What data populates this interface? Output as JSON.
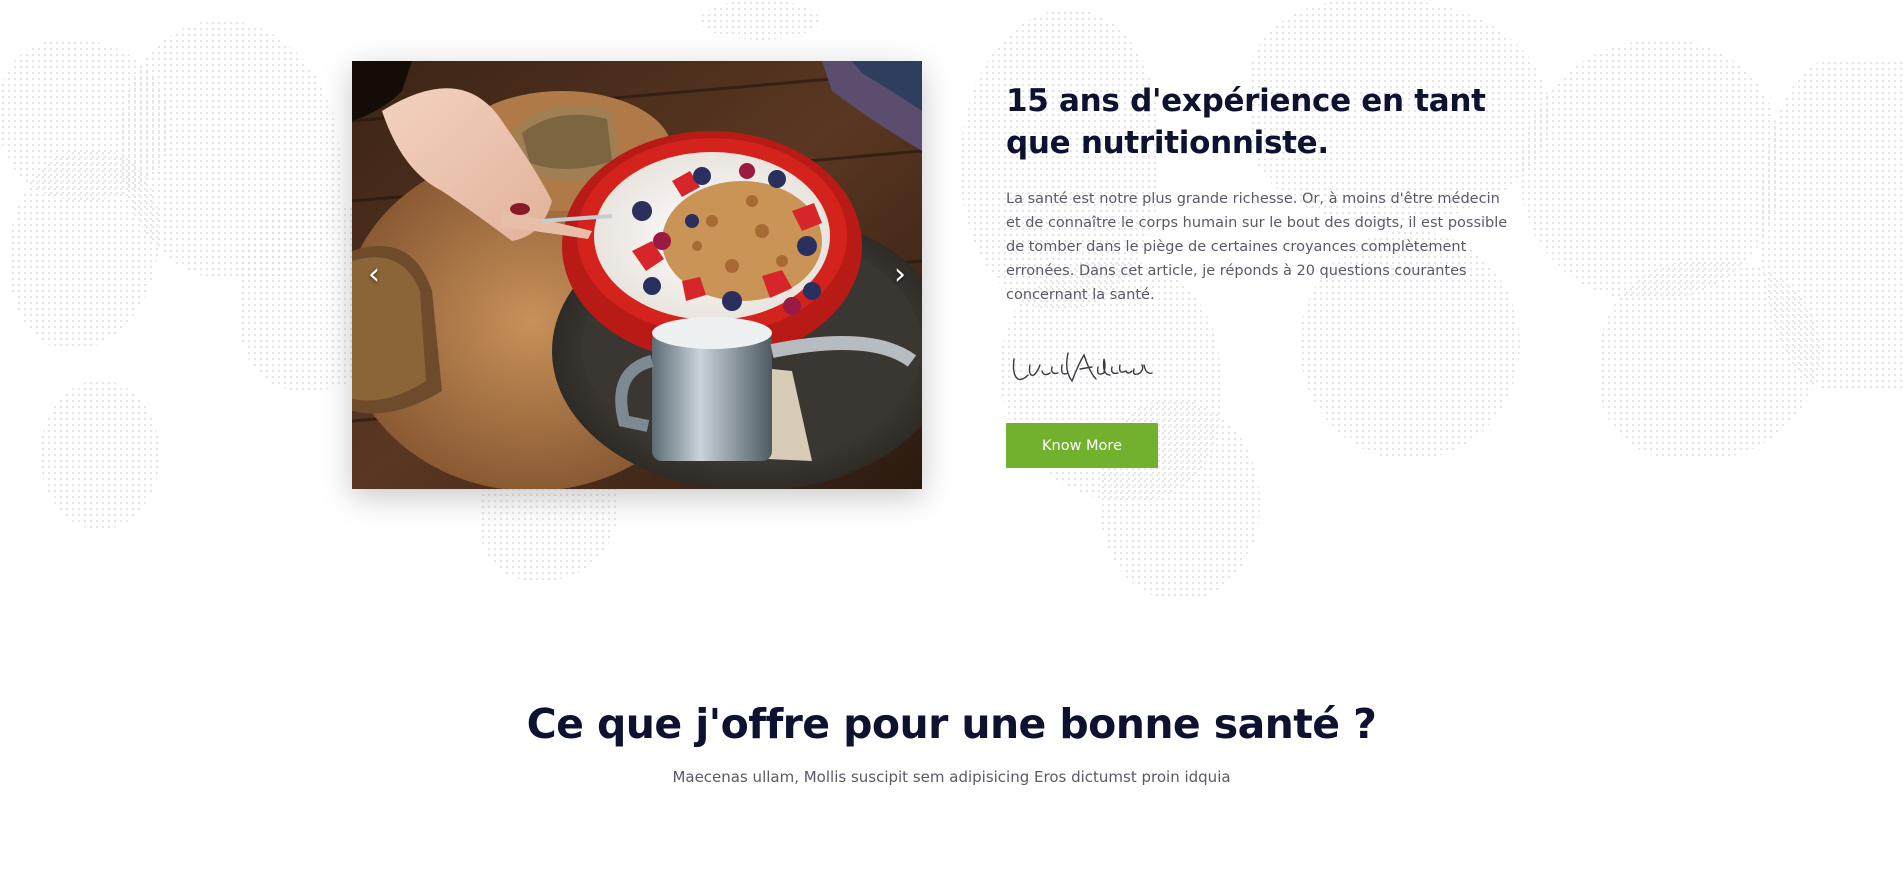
{
  "about": {
    "title": "15 ans d'expérience en tant que nutritionniste.",
    "description": "La santé est notre plus grande richesse. Or, à moins d'être médecin et de connaître le corps humain sur le bout des doigts, il est possible de tomber dans le piège de certaines croyances complètement erronées. Dans cet article, je réponds à 20 questions courantes concernant la santé.",
    "signature": "Lucie Anderson",
    "button_label": "Know More"
  },
  "carousel": {
    "prev_icon": "chevron-left-icon",
    "next_icon": "chevron-right-icon",
    "prev_glyph": "‹",
    "next_glyph": "›"
  },
  "services": {
    "title": "Ce que j'offre pour une bonne santé ?",
    "subtitle": "Maecenas ullam, Mollis suscipit sem adipisicing Eros dictumst proin idquia"
  },
  "colors": {
    "heading": "#0d1230",
    "body_text": "#5a5a66",
    "accent_green": "#72b12e",
    "map_dots": "#dedede"
  }
}
